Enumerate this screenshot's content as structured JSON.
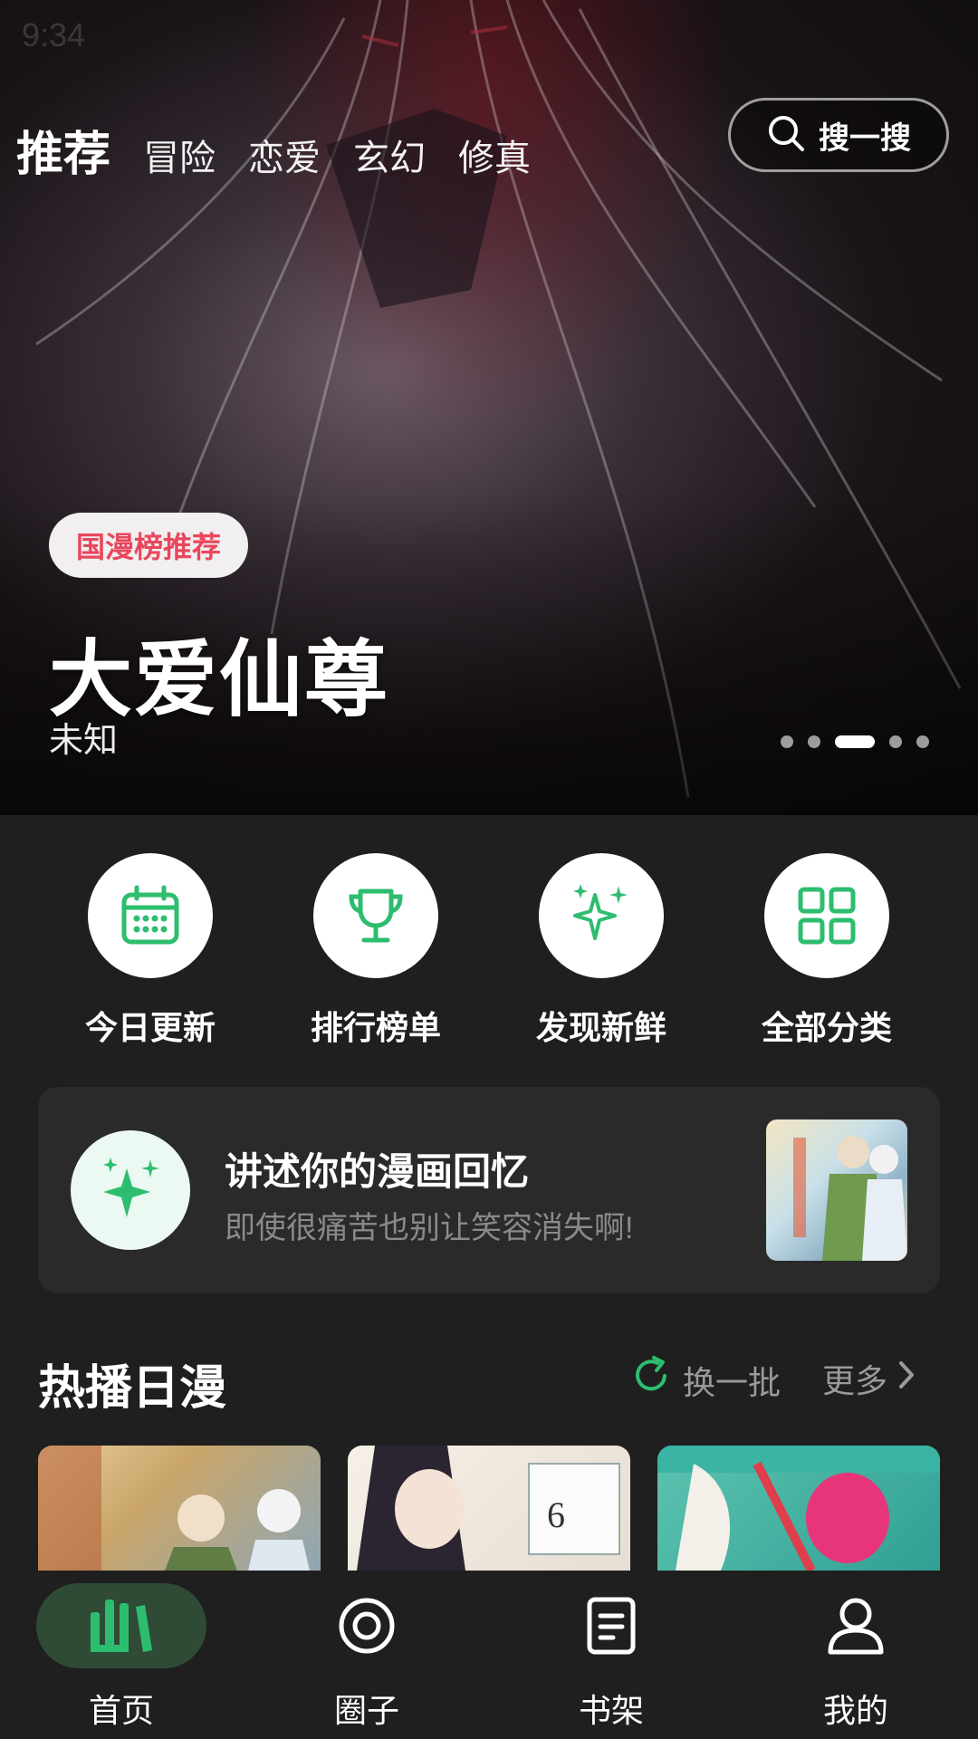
{
  "status": {
    "time": "9:34"
  },
  "nav": {
    "tabs": [
      "推荐",
      "冒险",
      "恋爱",
      "玄幻",
      "修真"
    ],
    "active_index": 0
  },
  "search": {
    "label": "搜一搜",
    "icon": "search-icon"
  },
  "banner": {
    "badge": "国漫榜推荐",
    "title": "大爱仙尊",
    "author": "未知",
    "carousel": {
      "count": 5,
      "active_index": 2
    }
  },
  "quick_actions": [
    {
      "label": "今日更新",
      "icon": "calendar-icon"
    },
    {
      "label": "排行榜单",
      "icon": "trophy-icon"
    },
    {
      "label": "发现新鲜",
      "icon": "sparkle-icon"
    },
    {
      "label": "全部分类",
      "icon": "grid-icon"
    }
  ],
  "memory_card": {
    "title": "讲述你的漫画回忆",
    "subtitle": "即使很痛苦也别让笑容消失啊!",
    "icon": "sparkle-icon"
  },
  "section": {
    "title": "热播日漫",
    "refresh_label": "换一批",
    "more_label": "更多"
  },
  "bottom_nav": [
    {
      "label": "首页",
      "icon": "home-bars-icon",
      "active": true
    },
    {
      "label": "圈子",
      "icon": "circle-target-icon",
      "active": false
    },
    {
      "label": "书架",
      "icon": "bookshelf-icon",
      "active": false
    },
    {
      "label": "我的",
      "icon": "user-icon",
      "active": false
    }
  ],
  "colors": {
    "accent": "#2dbd6e",
    "badge_text": "#e9475d",
    "background": "#1f1f1f"
  }
}
